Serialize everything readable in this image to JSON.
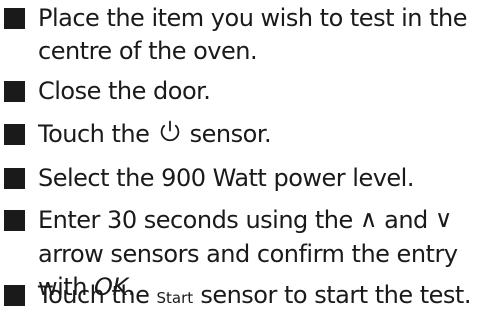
{
  "instructions": {
    "step1": {
      "line1": "Place the item you wish to test in the",
      "line2": "centre of the oven."
    },
    "step2": {
      "text": "Close the door."
    },
    "step3": {
      "before": "Touch the ",
      "icon": "power-icon",
      "after": " sensor."
    },
    "step4": {
      "text": "Select the 900 Watt power level."
    },
    "step5": {
      "before": "Enter 30 seconds using the ",
      "up_symbol": "∧",
      "middle": " and ",
      "down_symbol": "∨",
      "line2": "arrow sensors and confirm the entry",
      "line3_before": "with ",
      "ok": "OK",
      "line3_after": "."
    },
    "step6": {
      "before": "Touch the ",
      "start": "Start",
      "after": " sensor to start the test."
    }
  }
}
